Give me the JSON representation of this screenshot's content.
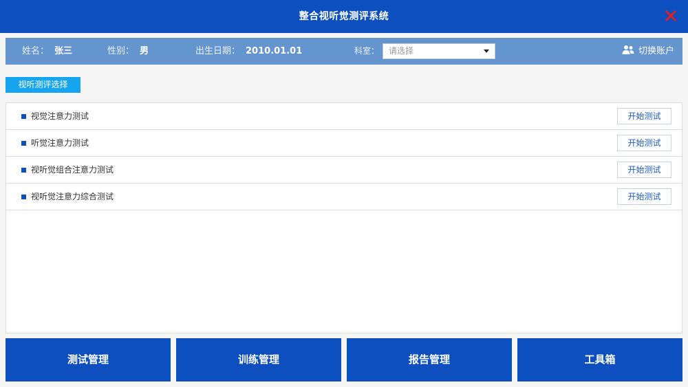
{
  "window": {
    "title": "整合视听觉测评系统"
  },
  "patient": {
    "name_label": "姓名：",
    "name": "张三",
    "gender_label": "性别：",
    "gender": "男",
    "birth_label": "出生日期：",
    "birth": "2010.01.01",
    "dept_label": "科室：",
    "dept_placeholder": "请选择"
  },
  "account": {
    "switch_label": "切换账户",
    "icon": "users-icon"
  },
  "tab": {
    "label": "视听测评选择"
  },
  "tests": [
    {
      "label": "视觉注意力测试",
      "button": "开始测试"
    },
    {
      "label": "听觉注意力测试",
      "button": "开始测试"
    },
    {
      "label": "视听觉组合注意力测试",
      "button": "开始测试"
    },
    {
      "label": "视听觉注意力综合测试",
      "button": "开始测试"
    }
  ],
  "nav": [
    {
      "label": "测试管理"
    },
    {
      "label": "训练管理"
    },
    {
      "label": "报告管理"
    },
    {
      "label": "工具箱"
    }
  ],
  "colors": {
    "primary": "#0d4fbe",
    "info_bar": "#6495cf",
    "tab_accent": "#17a4ee",
    "close": "#e02020"
  }
}
